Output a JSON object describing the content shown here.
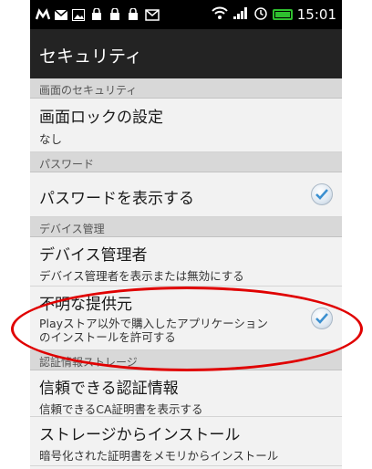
{
  "status_bar": {
    "time": "15:01",
    "left_icons": [
      "m-icon",
      "mail-icon",
      "image-icon",
      "bag-icon",
      "bag-icon",
      "bag-icon",
      "mail-icon"
    ],
    "right_icons": [
      "wifi-icon",
      "signal-icon",
      "alarm-icon",
      "battery-icon"
    ]
  },
  "title_bar": {
    "title": "セキュリティ"
  },
  "sections": {
    "screen_security": {
      "header": "画面のセキュリティ",
      "screen_lock": {
        "label": "画面ロックの設定",
        "summary": "なし"
      }
    },
    "password": {
      "header": "パスワード",
      "show_password": {
        "label": "パスワードを表示する",
        "checked": true
      }
    },
    "device_admin": {
      "header": "デバイス管理",
      "device_administrators": {
        "label": "デバイス管理者",
        "summary": "デバイス管理者を表示または無効にする"
      },
      "unknown_sources": {
        "label": "不明な提供元",
        "summary_line1": "Playストア以外で購入したアプリケーション",
        "summary_line2": "のインストールを許可する",
        "checked": true
      }
    },
    "credential_storage": {
      "header": "認証情報ストレージ",
      "trusted_credentials": {
        "label": "信頼できる認証情報",
        "summary": "信頼できるCA証明書を表示する"
      },
      "install_from_storage": {
        "label": "ストレージからインストール",
        "summary": "暗号化された証明書をメモリからインストール"
      }
    }
  },
  "colors": {
    "highlight": "#e00000",
    "battery": "#2fbf2f",
    "titlebar": "#232323"
  }
}
